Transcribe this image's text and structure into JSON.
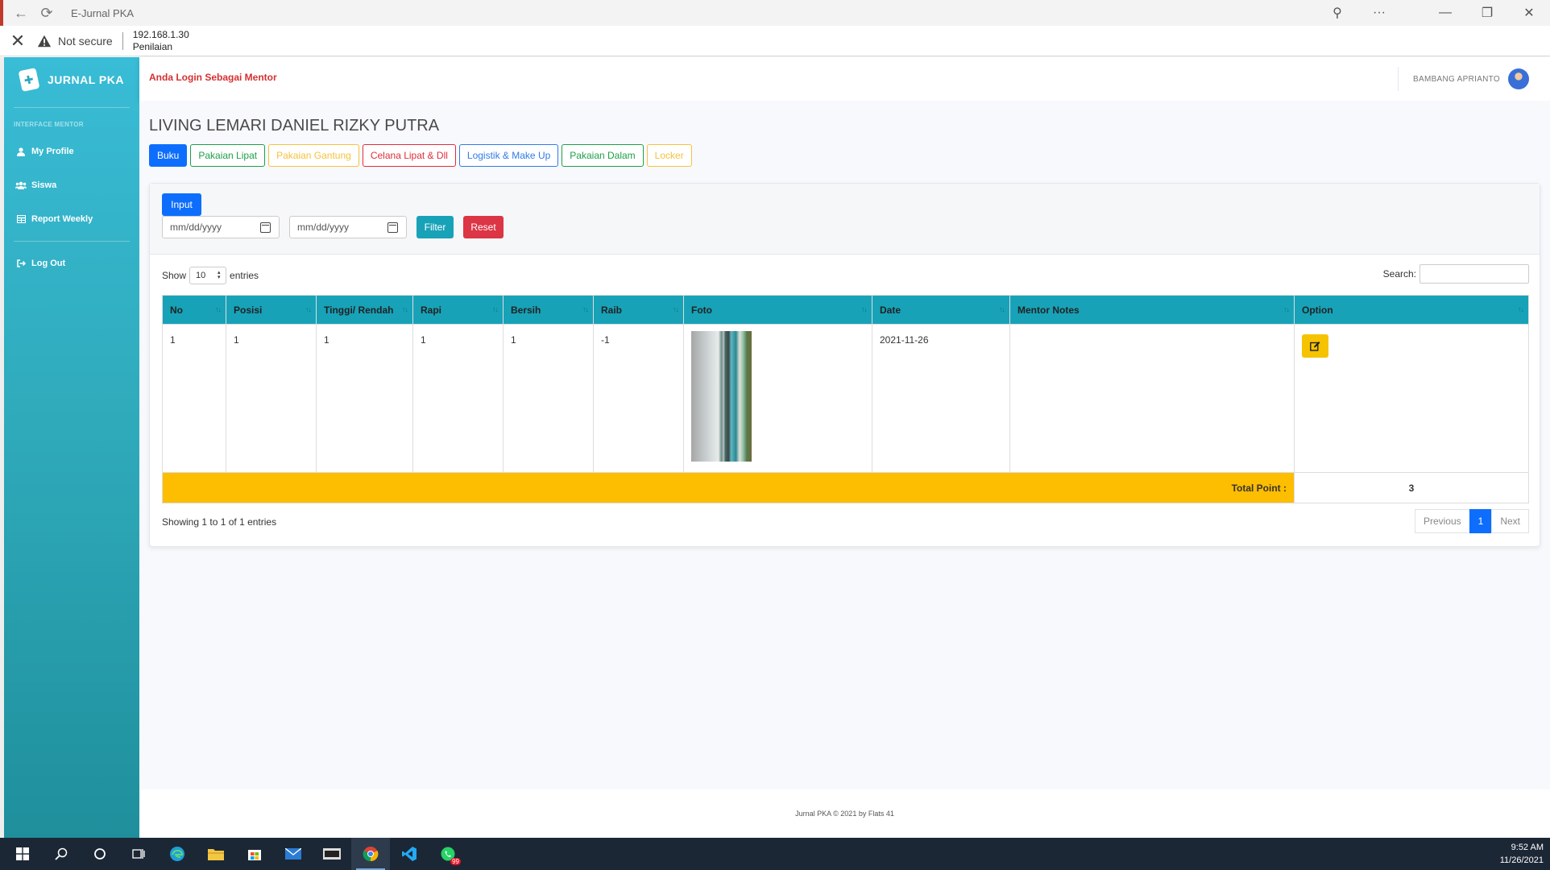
{
  "browser": {
    "tab_title": "E-Jurnal PKA",
    "security_label": "Not secure",
    "address_host": "192.168.1.30",
    "address_page": "Penilaian"
  },
  "sidebar": {
    "brand": "JURNAL PKA",
    "heading": "INTERFACE MENTOR",
    "items": [
      {
        "label": "My Profile",
        "icon": "user-icon"
      },
      {
        "label": "Siswa",
        "icon": "users-icon"
      },
      {
        "label": "Report Weekly",
        "icon": "table-icon"
      },
      {
        "label": "Log Out",
        "icon": "logout-icon"
      }
    ]
  },
  "topbar": {
    "login_note": "Anda Login Sebagai Mentor",
    "user_name": "BAMBANG APRIANTO"
  },
  "page": {
    "title": "LIVING LEMARI DANIEL RIZKY PUTRA",
    "tabs": [
      "Buku",
      "Pakaian Lipat",
      "Pakaian Gantung",
      "Celana Lipat & Dll",
      "Logistik & Make Up",
      "Pakaian Dalam",
      "Locker"
    ]
  },
  "filters": {
    "input_label": "Input",
    "date_from_placeholder": "mm/dd/yyyy",
    "date_to_placeholder": "mm/dd/yyyy",
    "filter_label": "Filter",
    "reset_label": "Reset"
  },
  "datatable": {
    "show_label": "Show",
    "page_length": "10",
    "entries_label": "entries",
    "search_label": "Search:",
    "columns": [
      "No",
      "Posisi",
      "Tinggi/ Rendah",
      "Rapi",
      "Bersih",
      "Raib",
      "Foto",
      "Date",
      "Mentor Notes",
      "Option"
    ],
    "rows": [
      {
        "no": "1",
        "posisi": "1",
        "tinggi_rendah": "1",
        "rapi": "1",
        "bersih": "1",
        "raib": "-1",
        "date": "2021-11-26",
        "mentor_notes": ""
      }
    ],
    "total_label": "Total Point :",
    "total_value": "3",
    "info": "Showing 1 to 1 of 1 entries",
    "prev_label": "Previous",
    "current_page": "1",
    "next_label": "Next"
  },
  "footer": {
    "text": "Jurnal PKA © 2021 by Flats 41"
  },
  "taskbar": {
    "time": "9:52 AM",
    "date": "11/26/2021",
    "whatsapp_badge": "99"
  }
}
